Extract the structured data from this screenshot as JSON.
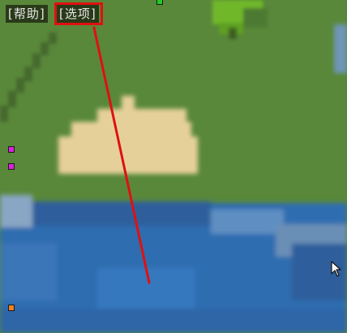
{
  "menu": {
    "help_label": "[帮助]",
    "options_label": "[选项]"
  },
  "markers": [
    {
      "name": "green-marker",
      "color": "#22cc22"
    },
    {
      "name": "magenta-marker",
      "color": "#e020e0"
    },
    {
      "name": "magenta-marker",
      "color": "#e020e0"
    },
    {
      "name": "orange-marker",
      "color": "#f08020"
    }
  ],
  "colors": {
    "grass": "#58873a",
    "sand": "#e6d09a",
    "water": "#2f6db0",
    "tree": "#6fb82a",
    "highlight": "#e01010",
    "pointer_line": "#e01010"
  }
}
